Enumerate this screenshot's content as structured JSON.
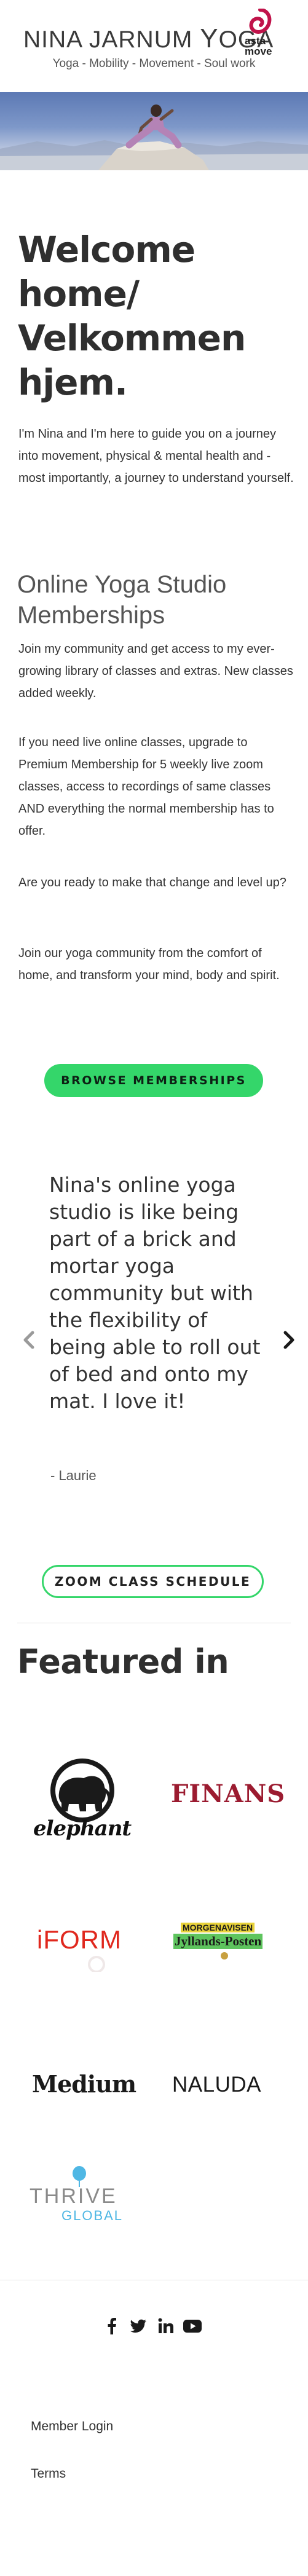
{
  "header": {
    "brand_prefix": "NINA JARNUM ",
    "brand_y": "Y",
    "brand_suffix": "OGA",
    "partner_line1": "asta",
    "partner_line2": "move",
    "tagline": "Yoga - Mobility - Movement - Soul work"
  },
  "colors": {
    "accent": "#34d66a",
    "text": "#2f2f2f",
    "finans": "#9b1b30",
    "iform": "#e0281e",
    "partner": "#c0134a"
  },
  "intro": {
    "heading": "Welcome home/ Velkommen hjem.",
    "paragraph": "I'm Nina and I'm here to guide you on a journey into movement, physical & mental health and - most importantly, a journey to understand yourself."
  },
  "memberships": {
    "heading": "Online Yoga Studio Memberships",
    "p1": "Join my community and get access to my ever-growing library of classes and extras. New classes added weekly.",
    "p2": "If you need live online classes, upgrade to Premium Membership for 5 weekly live zoom classes, access to recordings of same classes AND everything the normal membership has to offer.",
    "p3": "Are you ready to make that change and level up?",
    "p4": "Join our yoga community from the comfort of home, and transform your mind, body and spirit.",
    "button": "BROWSE MEMBERSHIPS"
  },
  "testimonial": {
    "quote": "Nina's online yoga studio is like being part of a brick and mortar yoga community but with the flexibility of being able to roll out of bed and onto my mat. I love it!",
    "author": "- Laurie"
  },
  "schedule_button": "ZOOM CLASS SCHEDULE",
  "featured": {
    "heading": "Featured in",
    "logos": {
      "elephant": "elephant",
      "finans": "FINANS",
      "iform": "iFORM",
      "jp_top": "MORGENAVISEN",
      "jp_bottom": "Jyllands-Posten",
      "medium": "Medium",
      "naluda": "NALUDA",
      "thrive": "THRIVE",
      "global": "GLOBAL"
    }
  },
  "footer": {
    "social": [
      "facebook-icon",
      "twitter-icon",
      "linkedin-icon",
      "youtube-icon"
    ],
    "links": [
      "Member Login",
      "Terms"
    ]
  }
}
